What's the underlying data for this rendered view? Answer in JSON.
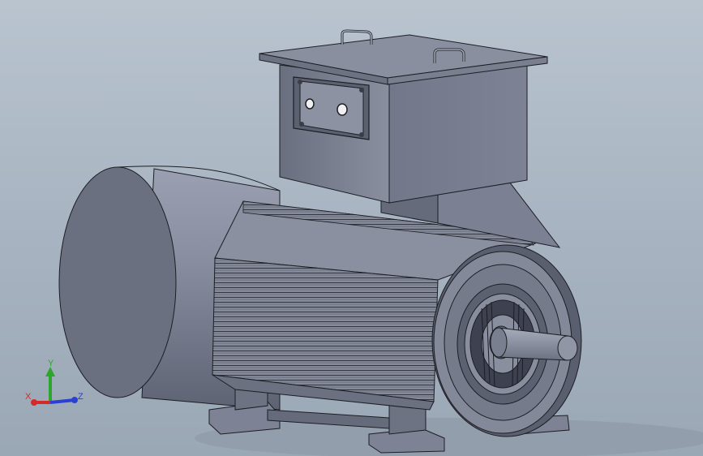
{
  "viewport": {
    "background_top": "#b9c4cf",
    "background_bottom": "#9aa7b5",
    "model_color": "#7f8596",
    "edge_color": "#1c1e24"
  },
  "triad": {
    "x_label": "X",
    "y_label": "Y",
    "z_label": "Z",
    "x_color": "#d42a2a",
    "y_color": "#2ea62e",
    "z_color": "#2a3fd4"
  }
}
